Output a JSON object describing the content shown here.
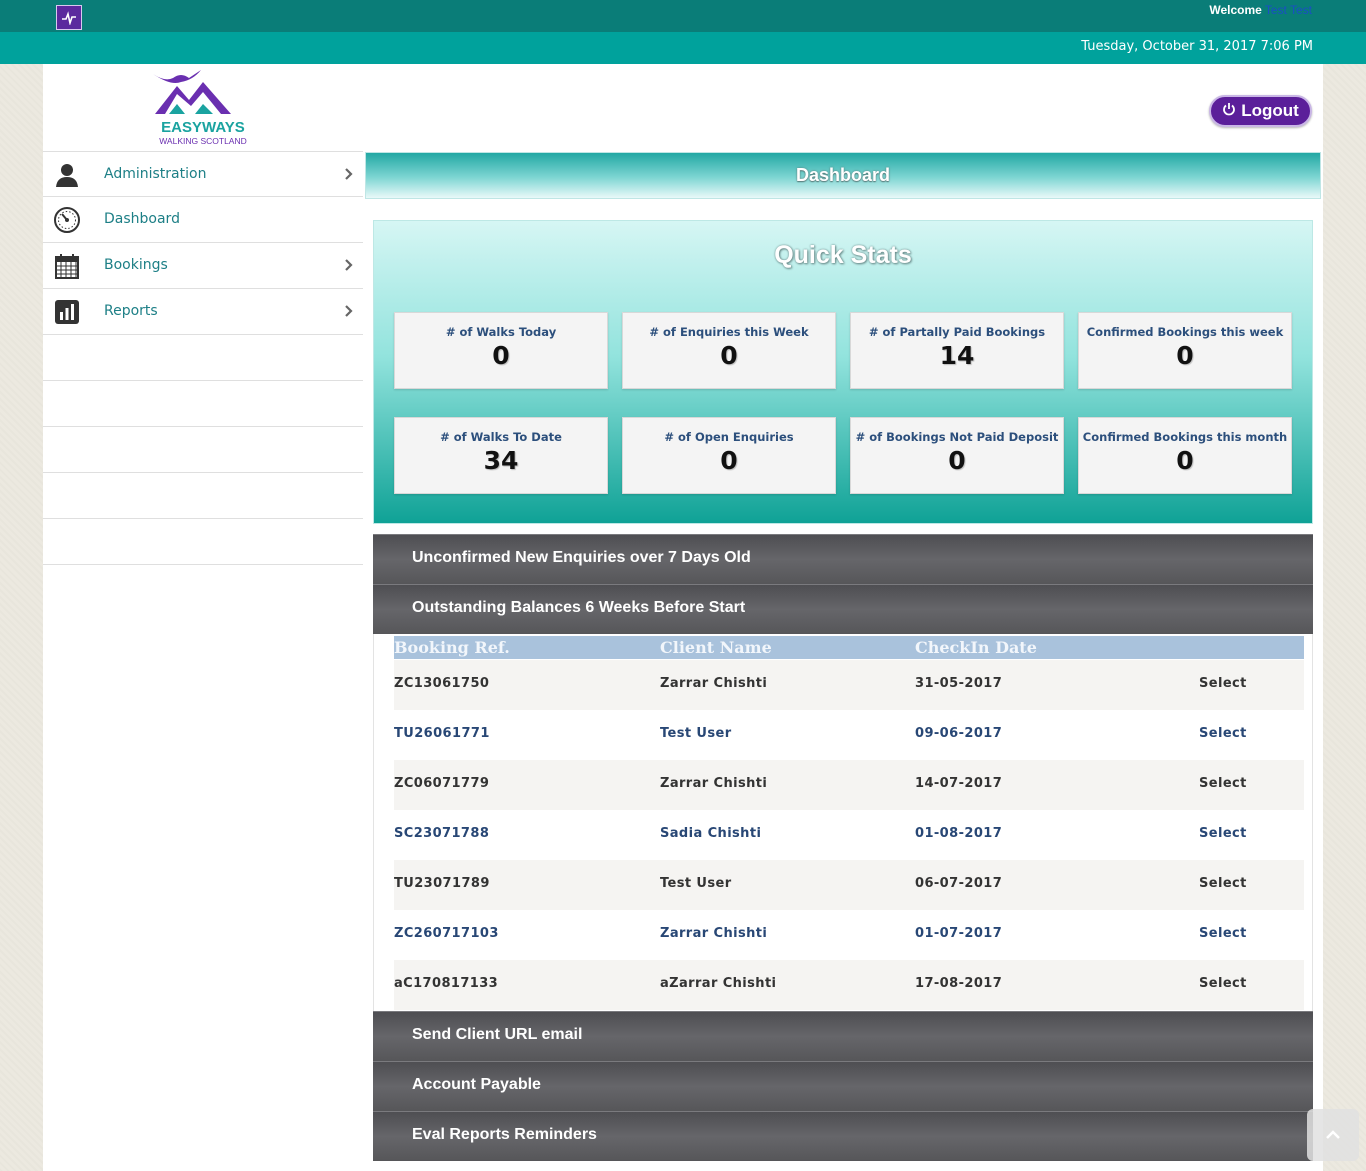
{
  "topbar": {
    "welcome_label": "Welcome",
    "welcome_user": "Test Test"
  },
  "datebar": {
    "date": "Tuesday, October 31, 2017 7:06 PM"
  },
  "header": {
    "logo_line1": "EASYWAYS",
    "logo_line2": "WALKING SCOTLAND",
    "logout_label": "Logout"
  },
  "sidebar": {
    "items": [
      {
        "label": "Administration",
        "icon": "user-icon",
        "has_children": true
      },
      {
        "label": "Dashboard",
        "icon": "speedometer-icon",
        "has_children": false
      },
      {
        "label": "Bookings",
        "icon": "calendar-icon",
        "has_children": true
      },
      {
        "label": "Reports",
        "icon": "bar-chart-icon",
        "has_children": true
      }
    ]
  },
  "main": {
    "page_title": "Dashboard",
    "quick_stats": {
      "title": "Quick Stats",
      "stats": [
        {
          "label": "# of Walks Today",
          "value": "0"
        },
        {
          "label": "# of Enquiries this Week",
          "value": "0"
        },
        {
          "label": "# of Partally Paid Bookings",
          "value": "14"
        },
        {
          "label": "Confirmed Bookings this week",
          "value": "0"
        },
        {
          "label": "# of Walks To Date",
          "value": "34"
        },
        {
          "label": "# of Open Enquiries",
          "value": "0"
        },
        {
          "label": "# of Bookings Not Paid Deposit",
          "value": "0"
        },
        {
          "label": "Confirmed Bookings this month",
          "value": "0"
        }
      ]
    },
    "sections": [
      "Unconfirmed New Enquiries over 7 Days Old",
      "Outstanding Balances 6 Weeks Before Start",
      "Send Client URL email",
      "Account Payable",
      "Eval Reports Reminders"
    ],
    "table": {
      "columns": [
        "Booking Ref.",
        "Client Name",
        "CheckIn Date"
      ],
      "rows": [
        {
          "ref": "ZC13061750",
          "client": "Zarrar Chishti",
          "date": "31-05-2017",
          "action": "Select"
        },
        {
          "ref": "TU26061771",
          "client": "Test User",
          "date": "09-06-2017",
          "action": "Select"
        },
        {
          "ref": "ZC06071779",
          "client": "Zarrar Chishti",
          "date": "14-07-2017",
          "action": "Select"
        },
        {
          "ref": "SC23071788",
          "client": "Sadia Chishti",
          "date": "01-08-2017",
          "action": "Select"
        },
        {
          "ref": "TU23071789",
          "client": "Test User",
          "date": "06-07-2017",
          "action": "Select"
        },
        {
          "ref": "ZC260717103",
          "client": "Zarrar Chishti",
          "date": "01-07-2017",
          "action": "Select"
        },
        {
          "ref": "aC170817133",
          "client": "aZarrar Chishti",
          "date": "17-08-2017",
          "action": "Select"
        }
      ]
    }
  },
  "colors": {
    "topbar": "#0a7d78",
    "datebar": "#00a29c",
    "brand_purple": "#5b1f9a",
    "brand_teal": "#1aa3a0"
  }
}
